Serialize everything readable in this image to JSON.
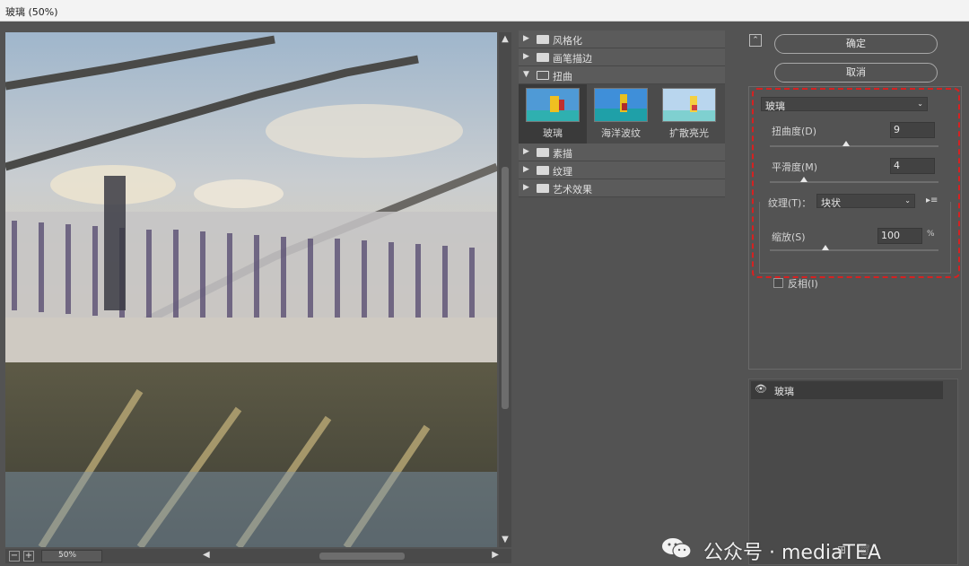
{
  "window": {
    "title": "玻璃 (50%)"
  },
  "preview": {
    "zoom": "50%",
    "zoom_out": "−",
    "zoom_in": "+"
  },
  "gallery": {
    "categories_top": [
      {
        "label": "风格化",
        "expanded": false
      },
      {
        "label": "画笔描边",
        "expanded": false
      },
      {
        "label": "扭曲",
        "expanded": true
      }
    ],
    "thumbnails": [
      {
        "label": "玻璃",
        "selected": true
      },
      {
        "label": "海洋波纹",
        "selected": false
      },
      {
        "label": "扩散亮光",
        "selected": false
      }
    ],
    "categories_bottom": [
      {
        "label": "素描",
        "expanded": false
      },
      {
        "label": "纹理",
        "expanded": false
      },
      {
        "label": "艺术效果",
        "expanded": false
      }
    ]
  },
  "actions": {
    "ok": "确定",
    "cancel": "取消"
  },
  "settings": {
    "filter": "玻璃",
    "distortion": {
      "label": "扭曲度(D)",
      "value": "9",
      "fraction": 0.45
    },
    "smoothness": {
      "label": "平滑度(M)",
      "value": "4",
      "fraction": 0.2
    },
    "texture": {
      "label": "纹理(T)：",
      "value": "块状"
    },
    "scaling": {
      "label": "缩放(S)",
      "value": "100",
      "unit": "%",
      "fraction": 0.33
    },
    "invert": {
      "label": "反相(I)",
      "checked": false
    }
  },
  "layers": [
    {
      "name": "玻璃",
      "visible": true
    }
  ],
  "watermark": {
    "text": "公众号 · mediaTEA"
  },
  "colors": {
    "highlight": "#d62121",
    "panel": "#535353"
  }
}
